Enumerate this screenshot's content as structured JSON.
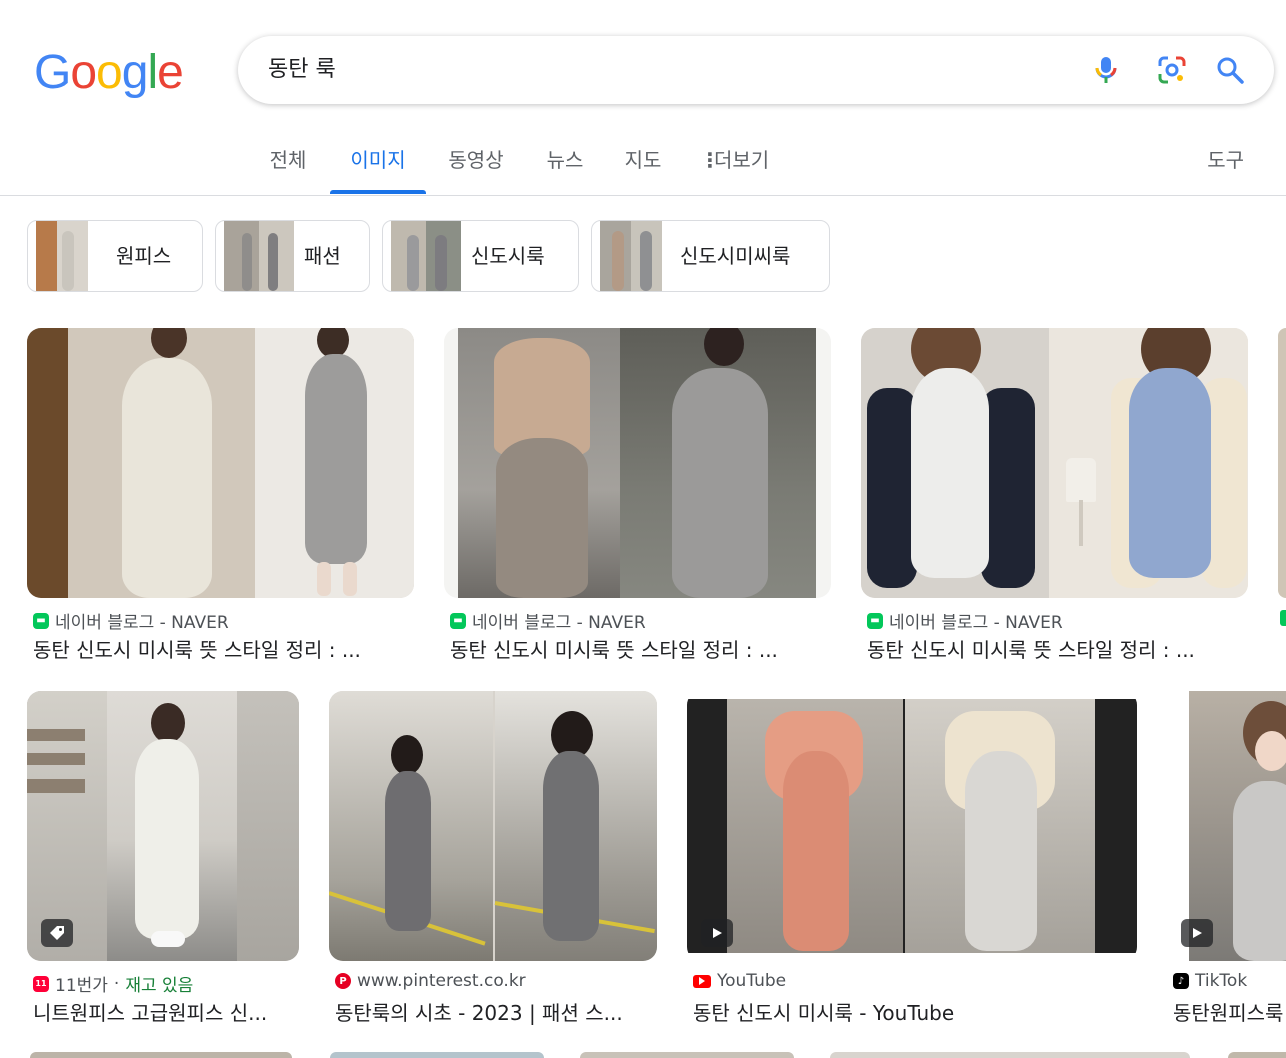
{
  "logo": {
    "letters": [
      "G",
      "o",
      "o",
      "g",
      "l",
      "e"
    ],
    "colors": [
      "#4285F4",
      "#EA4335",
      "#FBBC05",
      "#4285F4",
      "#34A853",
      "#EA4335"
    ]
  },
  "search": {
    "query": "동탄 룩"
  },
  "tabs": [
    {
      "label": "전체"
    },
    {
      "label": "이미지"
    },
    {
      "label": "동영상"
    },
    {
      "label": "뉴스"
    },
    {
      "label": "지도"
    },
    {
      "label": "더보기"
    }
  ],
  "tools_label": "도구",
  "chips": [
    {
      "label": "원피스"
    },
    {
      "label": "패션"
    },
    {
      "label": "신도시룩"
    },
    {
      "label": "신도시미씨룩"
    }
  ],
  "results": [
    {
      "source": "네이버 블로그 - NAVER",
      "title": "동탄 신도시 미시룩 뜻 스타일 정리 : ...",
      "icon": "naver-blog-icon"
    },
    {
      "source": "네이버 블로그 - NAVER",
      "title": "동탄 신도시 미시룩 뜻 스타일 정리 : ...",
      "icon": "naver-blog-icon"
    },
    {
      "source": "네이버 블로그 - NAVER",
      "title": "동탄 신도시 미시룩 뜻 스타일 정리 : ...",
      "icon": "naver-blog-icon"
    },
    {
      "source": "11번가",
      "source_extra": "재고 있음",
      "title": "니트원피스 고급원피스 신...",
      "icon": "11st-icon"
    },
    {
      "source": "www.pinterest.co.kr",
      "title": "동탄룩의 시초 - 2023 | 패션 스...",
      "icon": "pinterest-icon"
    },
    {
      "source": "YouTube",
      "title": "동탄 신도시 미시룩 - YouTube",
      "icon": "youtube-icon"
    },
    {
      "source": "TikTok",
      "title": "동탄원피스룩",
      "icon": "tiktok-icon"
    }
  ],
  "colors": {
    "accent": "#1a73e8",
    "naver": "#03c75a",
    "youtube": "#ff0000",
    "pinterest": "#e60023",
    "11st": "#ff0038"
  }
}
